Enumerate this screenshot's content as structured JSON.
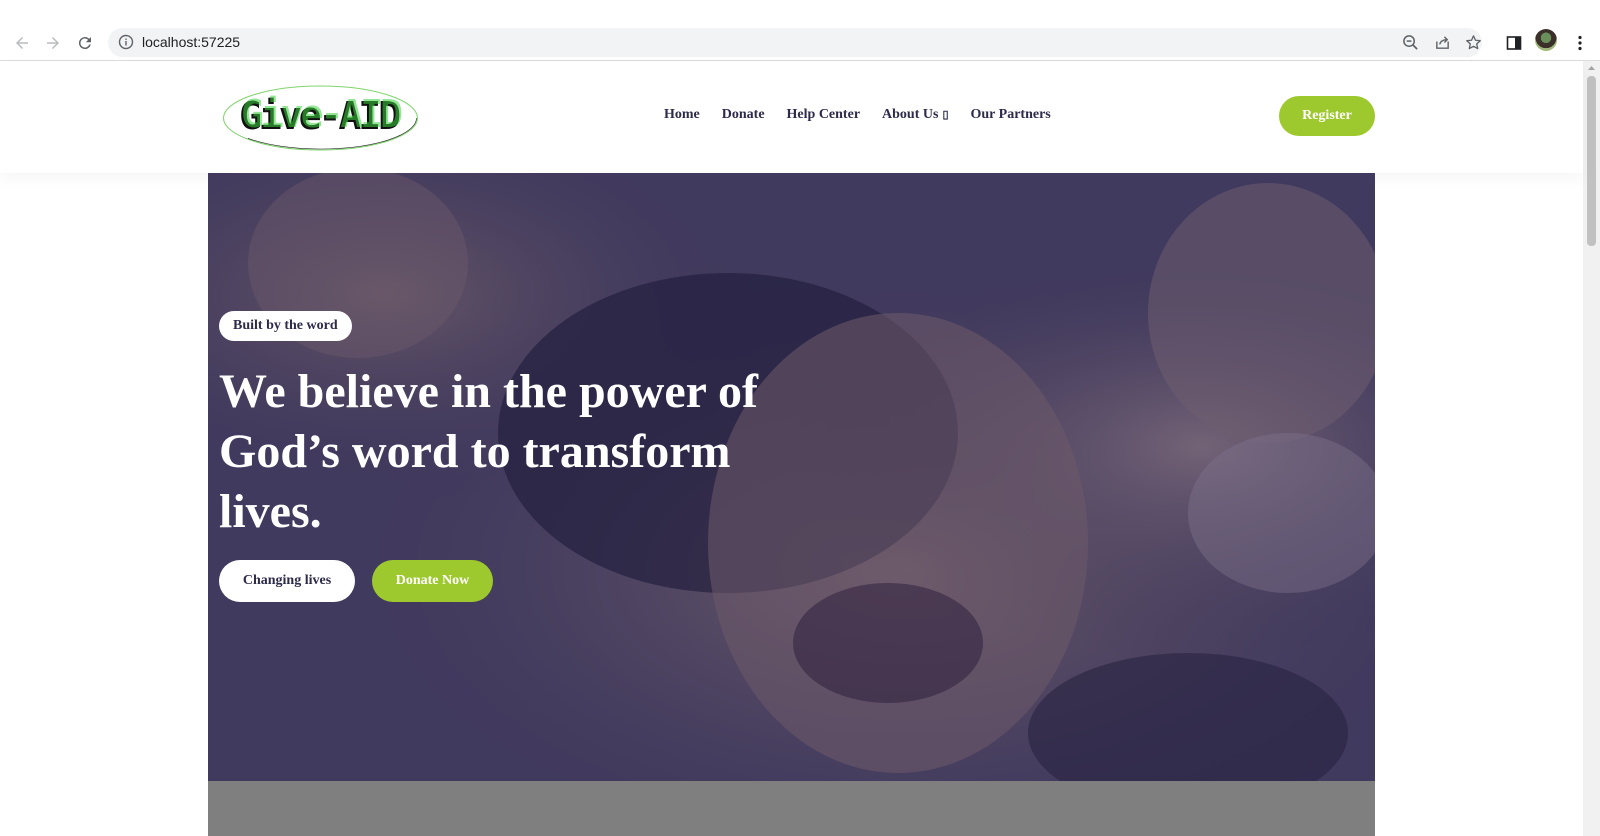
{
  "browser": {
    "url": "localhost:57225",
    "icons": [
      "back-arrow-icon",
      "forward-arrow-icon",
      "reload-icon",
      "info-icon",
      "zoom-out-icon",
      "share-icon",
      "star-icon",
      "side-panel-icon",
      "profile-avatar",
      "more-menu-icon"
    ]
  },
  "header": {
    "logo_text": "Give-AID",
    "nav": [
      {
        "label": "Home"
      },
      {
        "label": "Donate"
      },
      {
        "label": "Help Center"
      },
      {
        "label": "About Us",
        "caret": "▯"
      },
      {
        "label": "Our Partners"
      }
    ],
    "register_label": "Register"
  },
  "hero": {
    "badge": "Built by the word",
    "title": "We believe in the power of God’s word to transform lives.",
    "buttons": {
      "primary": "Changing lives",
      "secondary": "Donate Now"
    }
  },
  "colors": {
    "accent_green": "#9ec92e",
    "text_dark": "#2d2a4a",
    "overlay": "#262450"
  }
}
